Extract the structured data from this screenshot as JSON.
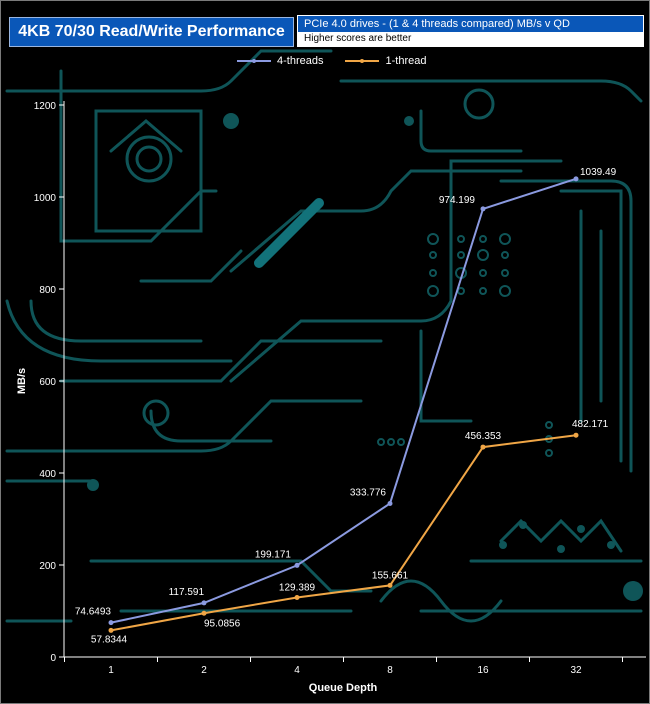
{
  "header": {
    "title": "4KB 70/30 Read/Write Performance",
    "subtitle": "PCIe 4.0 drives - (1 & 4 threads compared) MB/s v QD",
    "note": "Higher scores are better"
  },
  "colors": {
    "series_4": "#8b9ae0",
    "series_1": "#f0a646",
    "circuit": "#0f5558",
    "background": "#000000"
  },
  "chart_data": {
    "type": "line",
    "x": [
      "1",
      "2",
      "4",
      "8",
      "16",
      "32"
    ],
    "series": [
      {
        "name": "4-threads",
        "values": [
          74.6493,
          117.591,
          199.171,
          333.776,
          974.199,
          1039.49
        ],
        "labels": [
          "74.6493",
          "117.591",
          "199.171",
          "333.776",
          "974.199",
          "1039.49"
        ]
      },
      {
        "name": "1-thread",
        "values": [
          57.8344,
          95.0856,
          129.389,
          155.661,
          456.353,
          482.171
        ],
        "labels": [
          "57.8344",
          "95.0856",
          "129.389",
          "155.661",
          "456.353",
          "482.171"
        ]
      }
    ],
    "xlabel": "Queue Depth",
    "ylabel": "MB/s",
    "ylim": [
      0,
      1200
    ],
    "yticks": [
      "0",
      "200",
      "400",
      "600",
      "800",
      "1000",
      "1200"
    ],
    "grid": false,
    "legend": "top-center"
  }
}
